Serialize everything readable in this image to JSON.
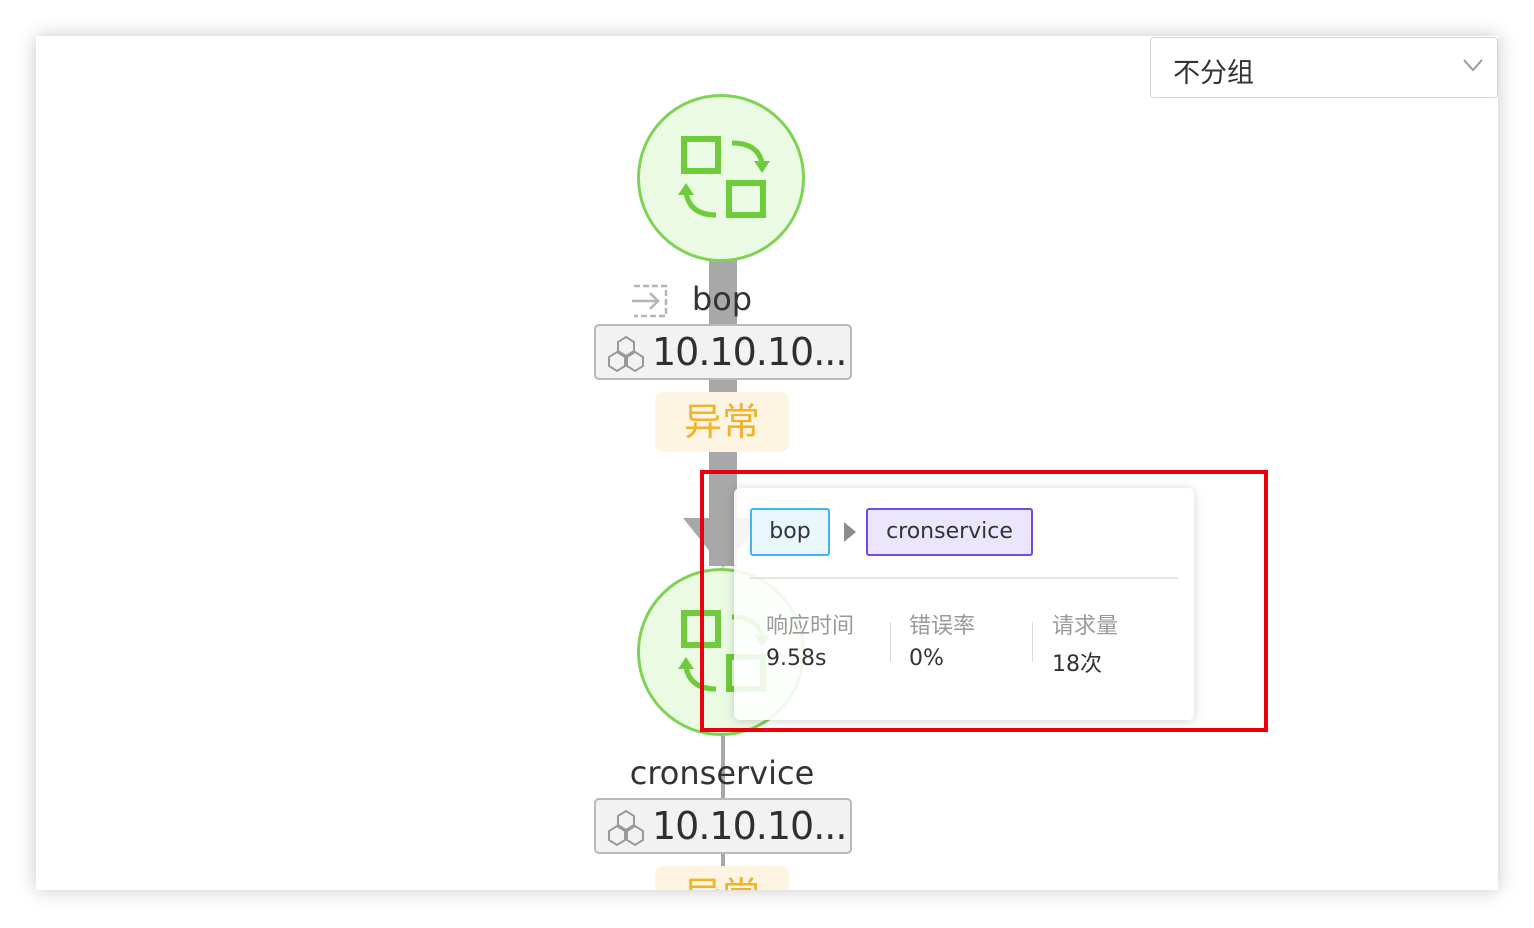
{
  "group_select": {
    "value": "不分组",
    "icon": "chevron-down-icon"
  },
  "nodes": [
    {
      "name": "bop",
      "ip": "10.10.10...",
      "status": "异常",
      "icon": "service-sync-icon"
    },
    {
      "name": "cronservice",
      "ip": "10.10.10...",
      "status": "异常",
      "icon": "service-sync-icon"
    }
  ],
  "tooltip": {
    "from": "bop",
    "to": "cronservice",
    "metrics": [
      {
        "label": "响应时间",
        "value": "9.58s"
      },
      {
        "label": "错误率",
        "value": "0%"
      },
      {
        "label": "请求量",
        "value": "18次"
      }
    ]
  },
  "colors": {
    "node_fill": "#ebfbe3",
    "node_stroke": "#7fd354",
    "status_text": "#f2b22a",
    "from_tag_border": "#45b3ef",
    "to_tag_border": "#6d4ce8",
    "highlight_box": "#e8000e"
  }
}
